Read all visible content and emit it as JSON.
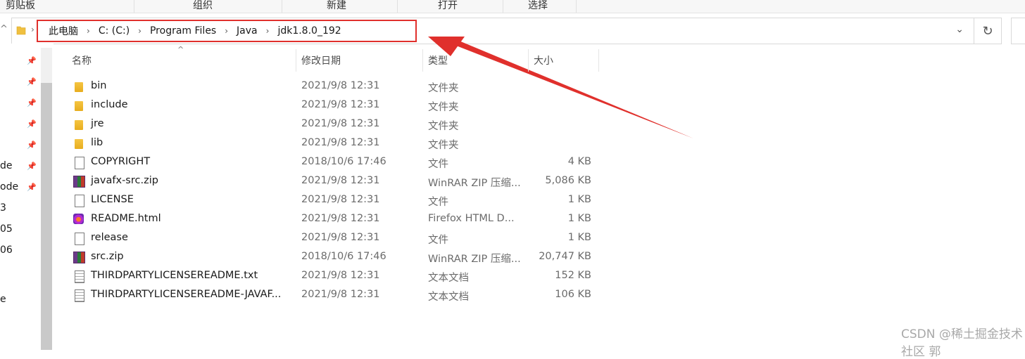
{
  "ribbon": {
    "groups": [
      "剪贴板",
      "组织",
      "新建",
      "打开",
      "选择"
    ]
  },
  "address_bar": {
    "breadcrumbs": [
      "此电脑",
      "C: (C:)",
      "Program Files",
      "Java",
      "jdk1.8.0_192"
    ]
  },
  "nav_pane": {
    "partial_items": [
      "de",
      "ode",
      "3",
      "05",
      "06",
      "e"
    ]
  },
  "columns": {
    "name": "名称",
    "date": "修改日期",
    "type": "类型",
    "size": "大小"
  },
  "files": [
    {
      "name": "bin",
      "date": "2021/9/8 12:31",
      "type": "文件夹",
      "size": "",
      "icon": "folder-icon"
    },
    {
      "name": "include",
      "date": "2021/9/8 12:31",
      "type": "文件夹",
      "size": "",
      "icon": "folder-icon"
    },
    {
      "name": "jre",
      "date": "2021/9/8 12:31",
      "type": "文件夹",
      "size": "",
      "icon": "folder-icon"
    },
    {
      "name": "lib",
      "date": "2021/9/8 12:31",
      "type": "文件夹",
      "size": "",
      "icon": "folder-icon"
    },
    {
      "name": "COPYRIGHT",
      "date": "2018/10/6 17:46",
      "type": "文件",
      "size": "4 KB",
      "icon": "file-icon"
    },
    {
      "name": "javafx-src.zip",
      "date": "2021/9/8 12:31",
      "type": "WinRAR ZIP 压缩...",
      "size": "5,086 KB",
      "icon": "winrar-zip-icon"
    },
    {
      "name": "LICENSE",
      "date": "2021/9/8 12:31",
      "type": "文件",
      "size": "1 KB",
      "icon": "file-icon"
    },
    {
      "name": "README.html",
      "date": "2021/9/8 12:31",
      "type": "Firefox HTML D...",
      "size": "1 KB",
      "icon": "firefox-html-icon"
    },
    {
      "name": "release",
      "date": "2021/9/8 12:31",
      "type": "文件",
      "size": "1 KB",
      "icon": "file-icon"
    },
    {
      "name": "src.zip",
      "date": "2018/10/6 17:46",
      "type": "WinRAR ZIP 压缩...",
      "size": "20,747 KB",
      "icon": "winrar-zip-icon"
    },
    {
      "name": "THIRDPARTYLICENSEREADME.txt",
      "date": "2021/9/8 12:31",
      "type": "文本文档",
      "size": "152 KB",
      "icon": "text-document-icon"
    },
    {
      "name": "THIRDPARTYLICENSEREADME-JAVAF...",
      "date": "2021/9/8 12:31",
      "type": "文本文档",
      "size": "106 KB",
      "icon": "text-document-icon"
    }
  ],
  "watermark": "CSDN @稀土掘金技术社区 郭",
  "annotation": {
    "highlight_color": "#e0302c",
    "arrow_color": "#e0302c"
  }
}
